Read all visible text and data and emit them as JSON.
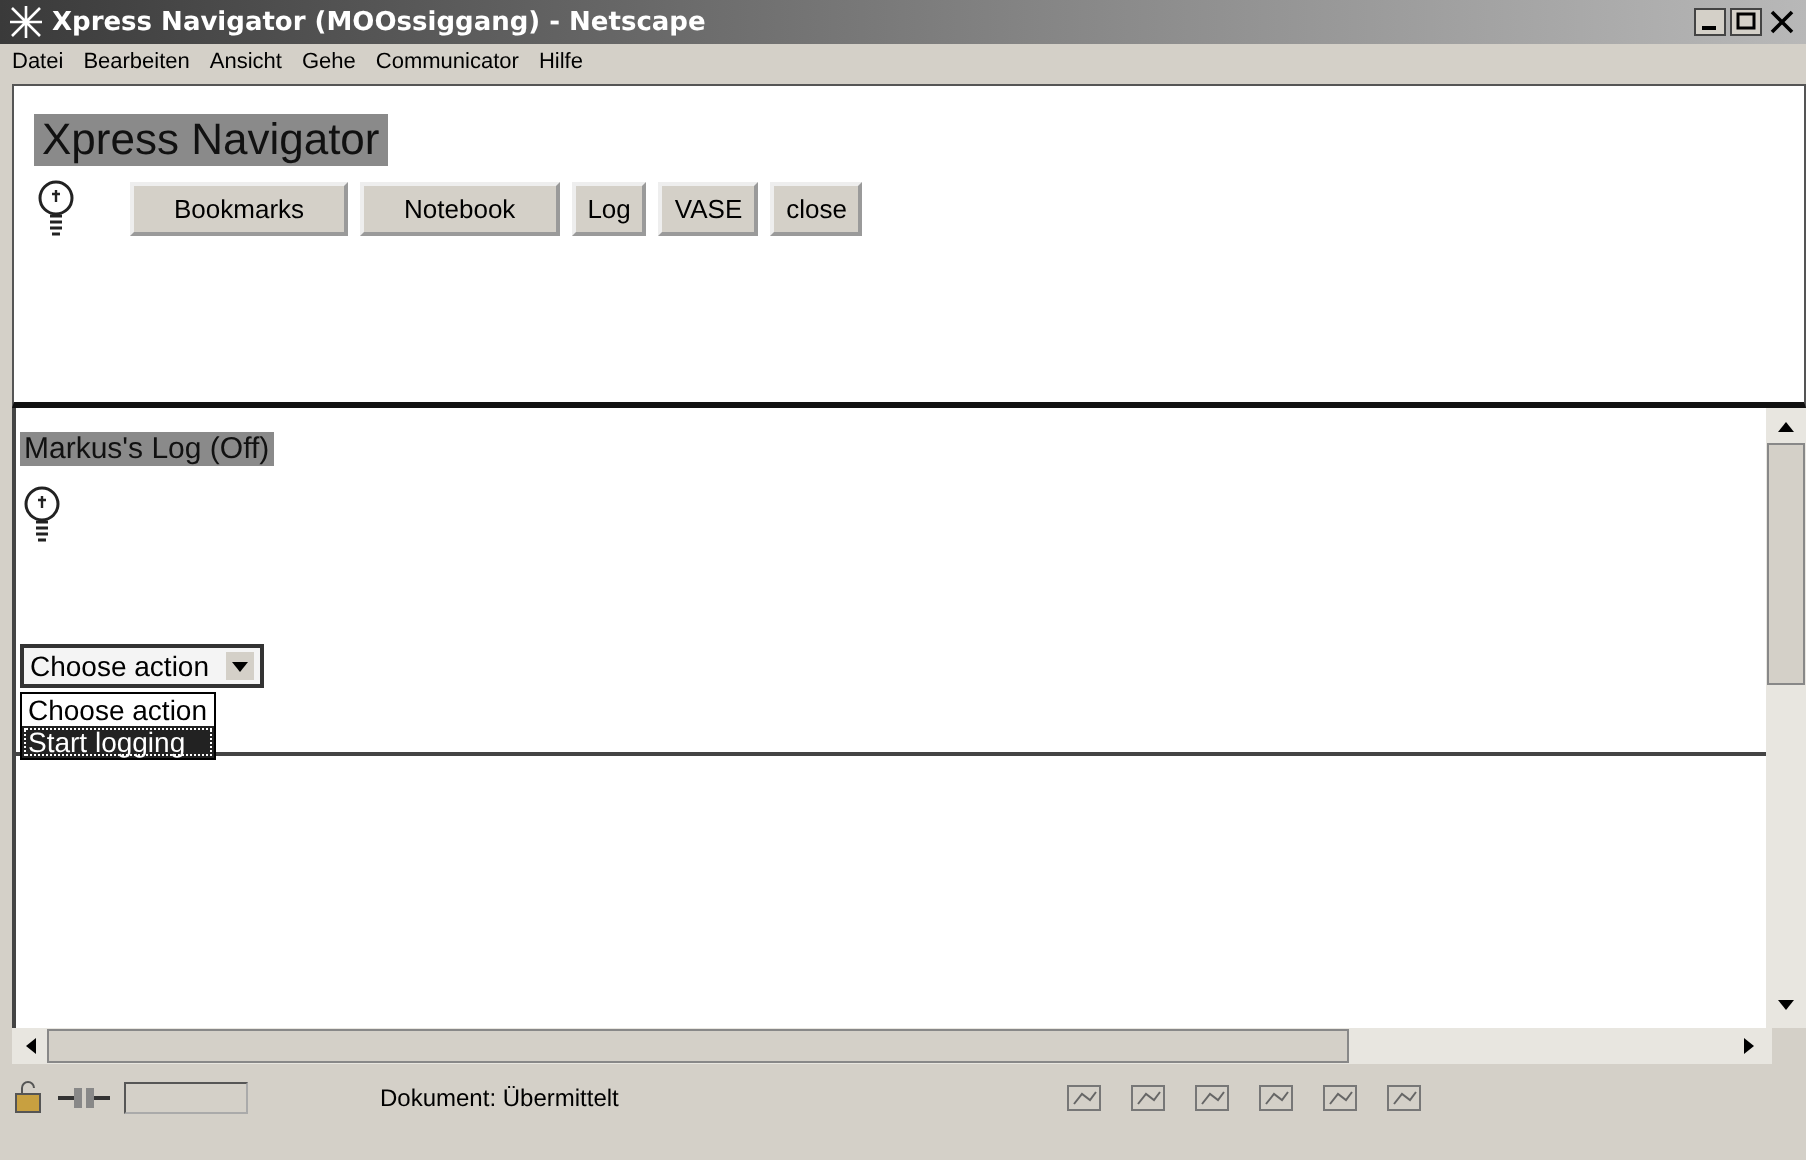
{
  "window": {
    "title": "Xpress Navigator (MOOssiggang) - Netscape"
  },
  "menu": [
    "Datei",
    "Bearbeiten",
    "Ansicht",
    "Gehe",
    "Communicator",
    "Hilfe"
  ],
  "top_frame": {
    "heading": "Xpress Navigator",
    "buttons": [
      "Bookmarks",
      "Notebook",
      "Log",
      "VASE",
      "close"
    ]
  },
  "log_frame": {
    "heading": "Markus's Log (Off)",
    "action_select": {
      "value": "Choose action",
      "expanded": true,
      "options": [
        {
          "label": "Choose action",
          "highlighted": false
        },
        {
          "label": "Start logging",
          "highlighted": true
        }
      ]
    }
  },
  "status_bar": {
    "text": "Dokument: Übermittelt"
  }
}
